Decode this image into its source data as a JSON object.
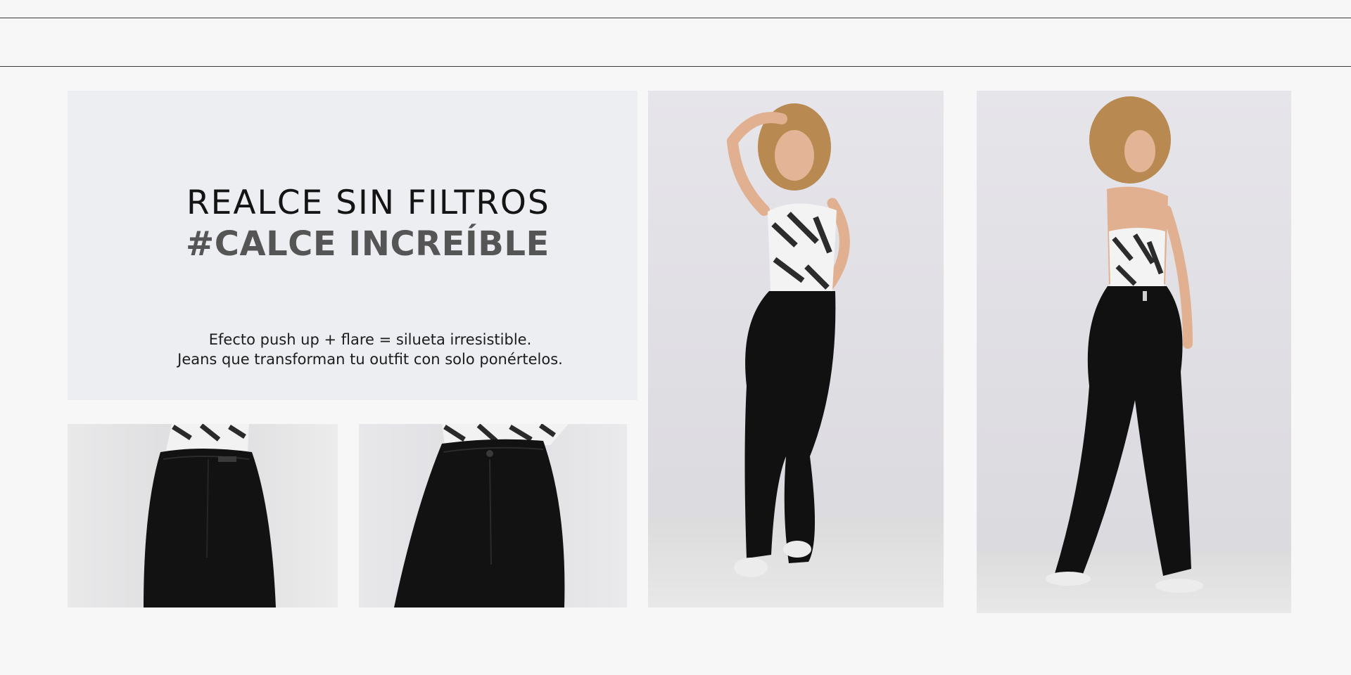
{
  "hero": {
    "line1": "REALCE SIN FILTROS",
    "line2": "#CALCE INCREÍBLE",
    "body_line1": "Efecto push up + flare = silueta irresistible.",
    "body_line2": "Jeans que transforman tu outfit con solo ponértelos."
  },
  "colors": {
    "page_bg": "#f7f7f7",
    "panel_bg": "#edeef2",
    "heading": "#141414",
    "subheading": "#555555"
  }
}
